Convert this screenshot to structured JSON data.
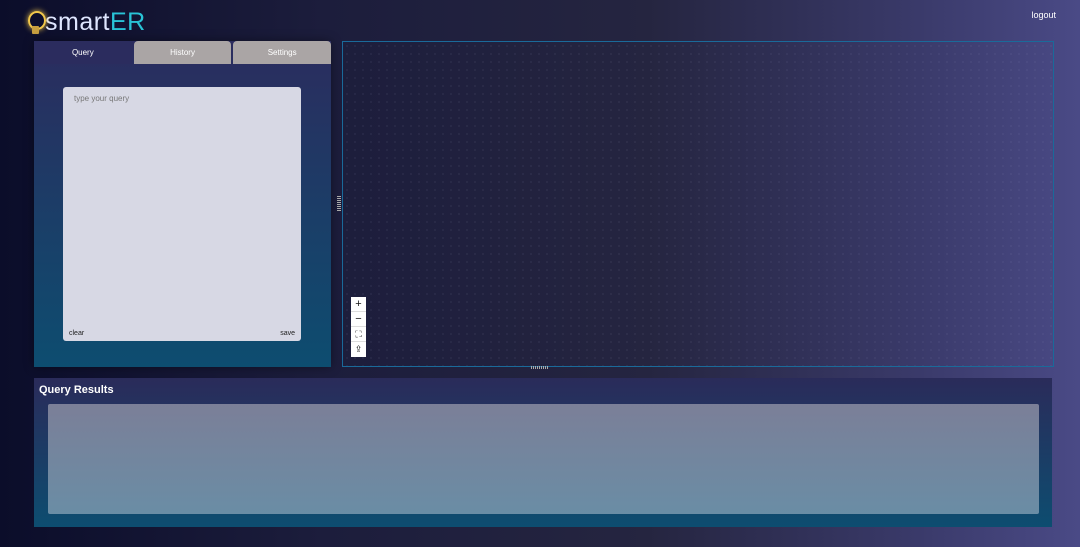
{
  "brand": {
    "part1": "smart",
    "part2": "ER"
  },
  "header": {
    "logout_label": "logout"
  },
  "tabs": [
    {
      "label": "Query"
    },
    {
      "label": "History"
    },
    {
      "label": "Settings"
    }
  ],
  "query": {
    "placeholder": "type your query",
    "value": "",
    "clear_label": "clear",
    "save_label": "save"
  },
  "canvas_controls": {
    "zoom_in": "+",
    "zoom_out": "−",
    "fit": "⛶",
    "export": "⇪"
  },
  "results": {
    "title": "Query Results"
  }
}
